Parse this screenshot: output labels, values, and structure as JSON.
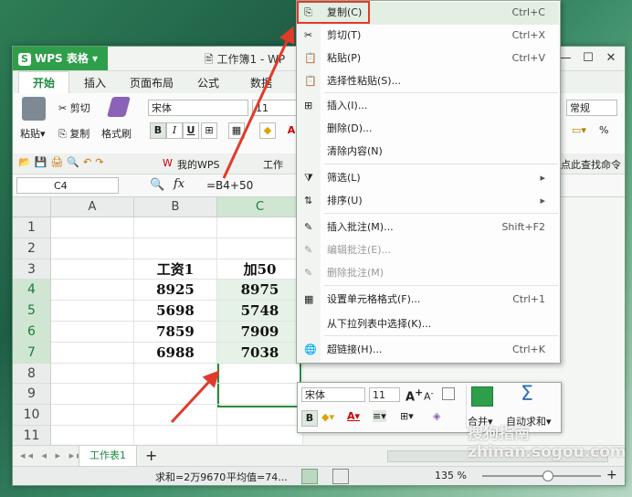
{
  "app": {
    "logo": "WPS 表格",
    "doc_title": "工作簿1 - WP"
  },
  "tabs": [
    "开始",
    "插入",
    "页面布局",
    "公式",
    "数据"
  ],
  "ribbon": {
    "paste": "粘贴",
    "cut": "剪切",
    "copy": "复制",
    "format_painter": "格式刷",
    "font_name": "宋体",
    "font_size": "11",
    "number_format": "常规",
    "percent": "%"
  },
  "quick_access": {
    "my_wps": "我的WPS",
    "workbook_tab": "工作",
    "find_cmd": "点此查找命令"
  },
  "formula_bar": {
    "name_box": "C4",
    "fx": "fx",
    "formula": "=B4+50"
  },
  "columns": [
    "A",
    "B",
    "C"
  ],
  "rows": [
    "1",
    "2",
    "3",
    "4",
    "5",
    "6",
    "7",
    "8",
    "9",
    "10",
    "11"
  ],
  "cells": {
    "B3": "工资1",
    "C3": "加50",
    "B4": "8925",
    "C4": "8975",
    "B5": "5698",
    "C5": "5748",
    "B6": "7859",
    "C6": "7909",
    "B7": "6988",
    "C7": "7038"
  },
  "sheet_tab": "工作表1",
  "status": {
    "sum": "求和=2万9670",
    "avg": "平均值=74...",
    "zoom": "135 %"
  },
  "context_menu": [
    {
      "label": "复制(C)",
      "shortcut": "Ctrl+C",
      "icon": "copy-icon"
    },
    {
      "label": "剪切(T)",
      "shortcut": "Ctrl+X",
      "icon": "scissors-icon"
    },
    {
      "label": "粘贴(P)",
      "shortcut": "Ctrl+V",
      "icon": "paste-icon"
    },
    {
      "label": "选择性粘贴(S)...",
      "shortcut": "",
      "icon": "paste-special-icon"
    },
    {
      "label": "插入(I)...",
      "shortcut": "",
      "icon": "insert-icon"
    },
    {
      "label": "删除(D)...",
      "shortcut": "",
      "icon": ""
    },
    {
      "label": "清除内容(N)",
      "shortcut": "",
      "icon": ""
    },
    {
      "label": "筛选(L)",
      "shortcut": "",
      "icon": "filter-icon"
    },
    {
      "label": "排序(U)",
      "shortcut": "",
      "icon": "sort-icon"
    },
    {
      "label": "插入批注(M)...",
      "shortcut": "Shift+F2",
      "icon": "comment-add-icon"
    },
    {
      "label": "编辑批注(E)...",
      "shortcut": "",
      "icon": "comment-edit-icon"
    },
    {
      "label": "删除批注(M)",
      "shortcut": "",
      "icon": "comment-delete-icon"
    },
    {
      "label": "设置单元格格式(F)...",
      "shortcut": "Ctrl+1",
      "icon": "format-cells-icon"
    },
    {
      "label": "从下拉列表中选择(K)...",
      "shortcut": "",
      "icon": ""
    },
    {
      "label": "超链接(H)...",
      "shortcut": "Ctrl+K",
      "icon": "hyperlink-icon"
    }
  ],
  "mini_toolbar": {
    "font_name": "宋体",
    "font_size": "11",
    "merge": "合并",
    "autosum": "自动求和"
  },
  "watermark": "搜狗指南 zhinan.sogou.com",
  "colors": {
    "accent_green": "#2f9e4a",
    "annotation_red": "#e23a2a"
  }
}
